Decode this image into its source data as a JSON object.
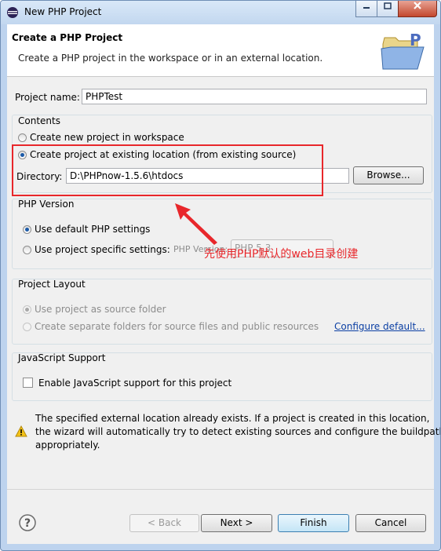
{
  "window": {
    "title": "New PHP Project",
    "minimize_icon": "minimize-icon",
    "maximize_icon": "maximize-icon",
    "close_icon": "close-icon"
  },
  "banner": {
    "title": "Create a PHP Project",
    "description": "Create a PHP project in the workspace or in an external location.",
    "image_icon": "php-folder-icon"
  },
  "project_name": {
    "label": "Project name:",
    "value": "PHPTest"
  },
  "contents": {
    "title": "Contents",
    "option_new": "Create new project in workspace",
    "option_existing": "Create project at existing location (from existing source)",
    "selected": "existing",
    "directory_label": "Directory:",
    "directory_value": "D:\\PHPnow-1.5.6\\htdocs",
    "browse_label": "Browse..."
  },
  "php_version": {
    "title": "PHP Version",
    "option_default": "Use default PHP settings",
    "option_specific": "Use project specific settings:",
    "selected": "default",
    "version_label": "PHP Version:",
    "version_value": "PHP 5.3"
  },
  "project_layout": {
    "title": "Project Layout",
    "option_source": "Use project as source folder",
    "option_separate": "Create separate folders for source files and public resources",
    "selected": "source",
    "configure_link": "Configure default..."
  },
  "javascript": {
    "title": "JavaScript Support",
    "checkbox_label": "Enable JavaScript support for this project",
    "checked": false
  },
  "warning": {
    "icon": "warning-icon",
    "text_line1": "The specified external location already exists. If a project is created in this location,",
    "text_line2": "the wizard will automatically try to detect existing sources and configure the buildpath",
    "text_line3": "appropriately."
  },
  "buttons": {
    "help_icon": "help-icon",
    "back": "< Back",
    "next": "Next >",
    "finish": "Finish",
    "cancel": "Cancel"
  },
  "annotation": {
    "text": "先使用PHP默认的web目录创建",
    "color": "#e8272b"
  },
  "colors": {
    "accent": "#3c7fb1",
    "link": "#0b3fa3",
    "annotation": "#e8272b"
  }
}
